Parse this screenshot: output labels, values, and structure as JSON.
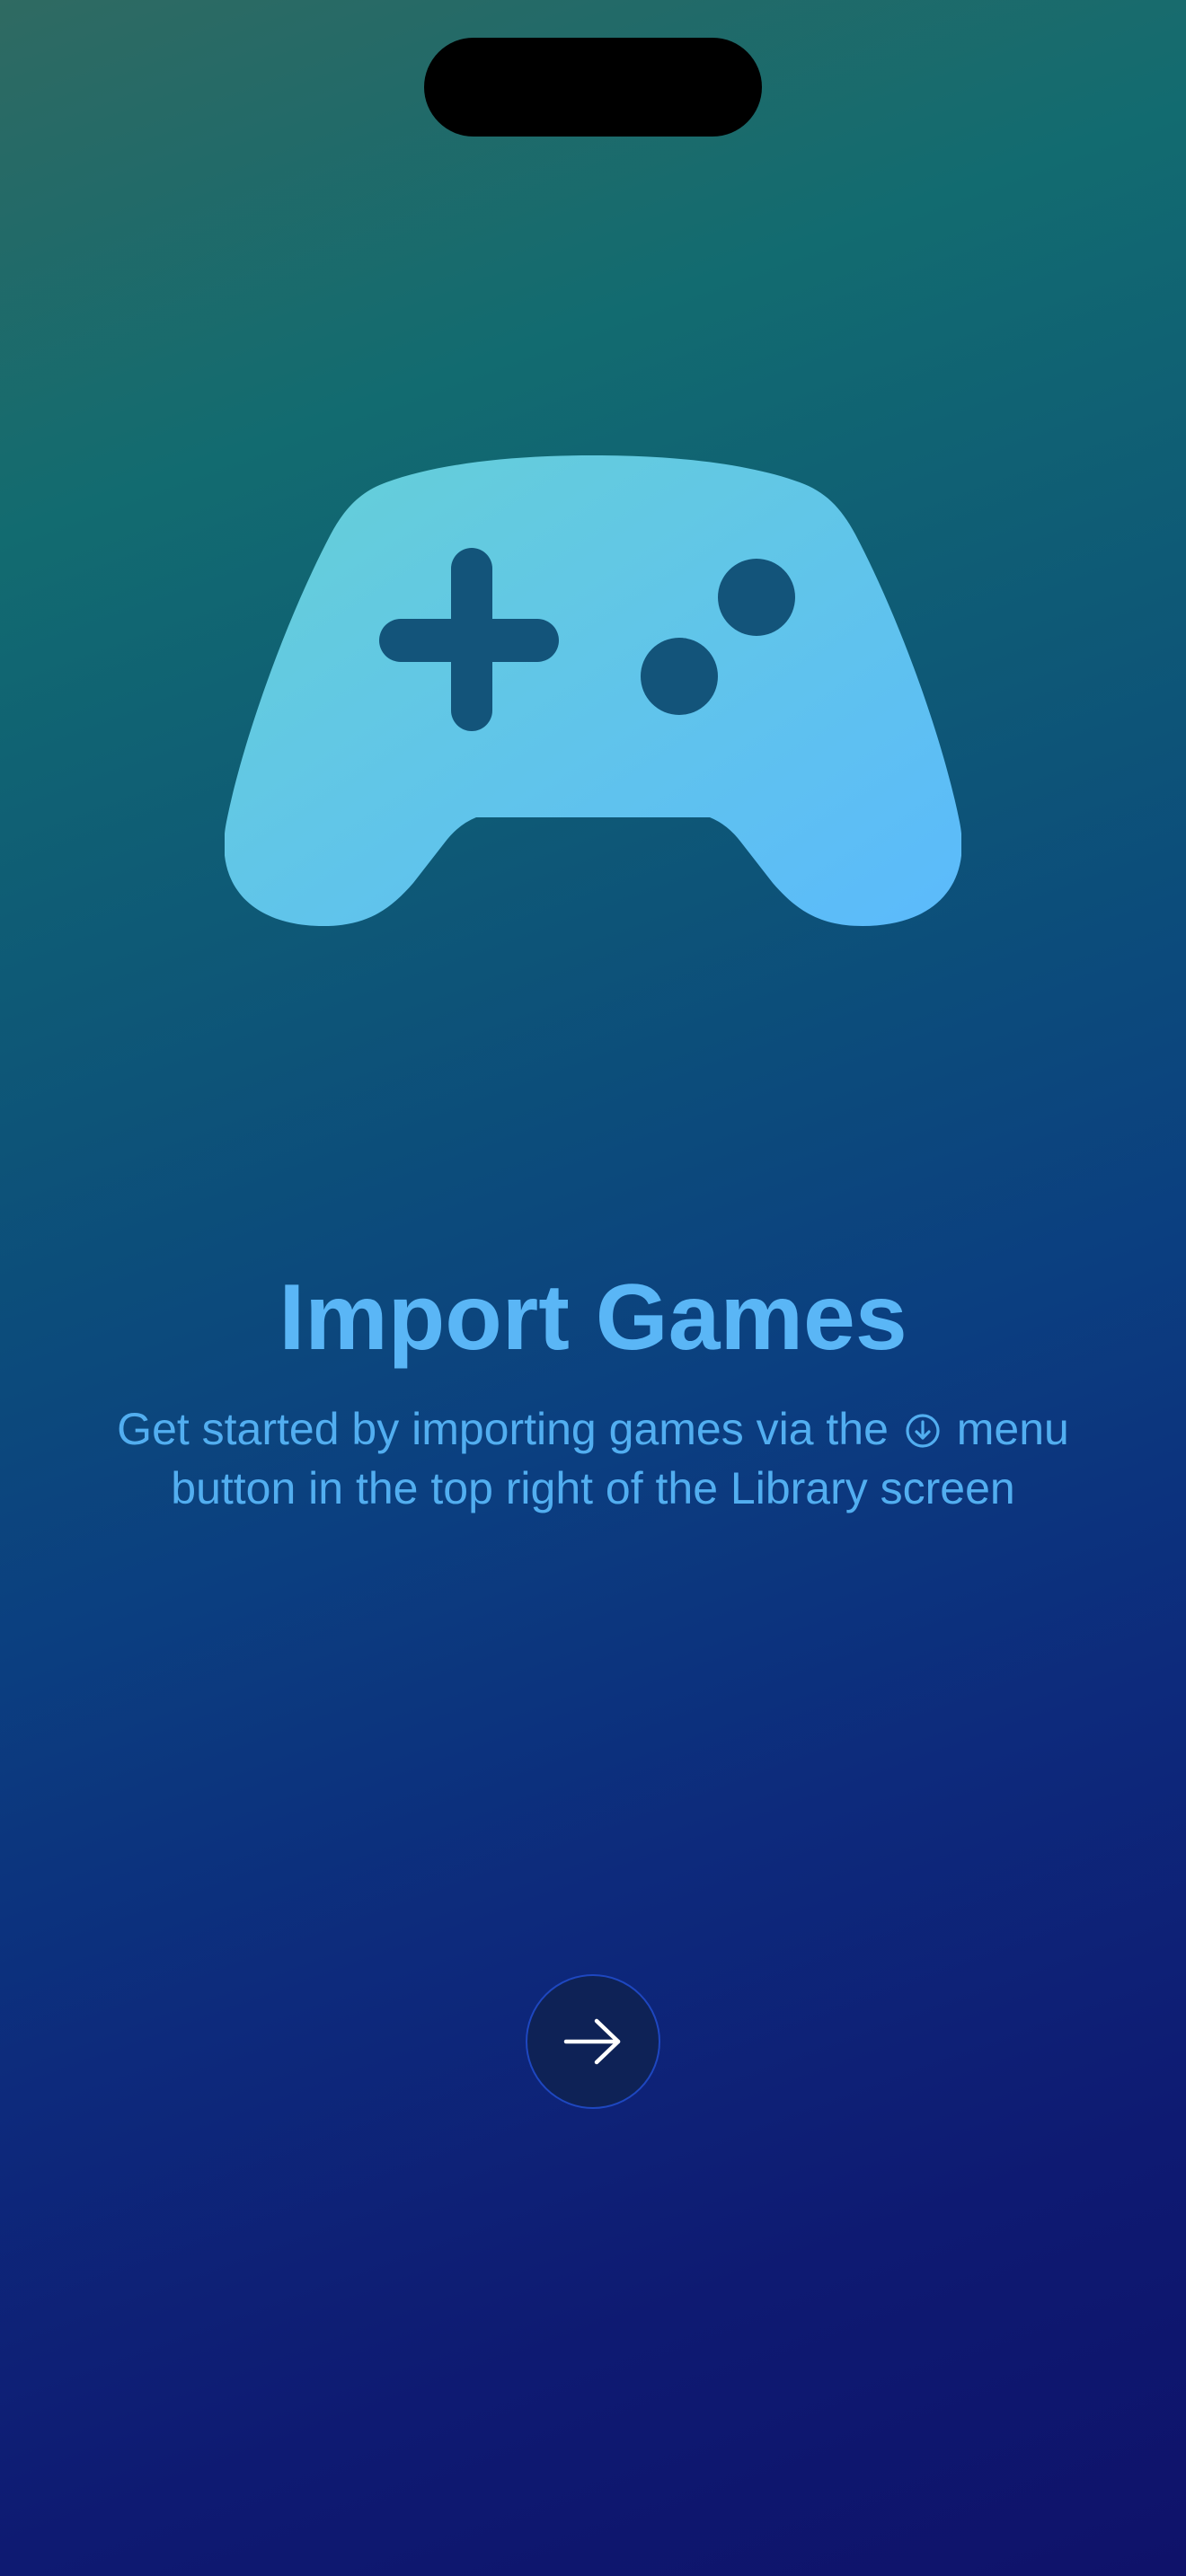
{
  "colors": {
    "accent": "#5ab6f6",
    "icon_gradient_start": "#63cfd9",
    "icon_gradient_end": "#5bbcfb",
    "button_fill": "#0e2256",
    "button_border": "#1e47c0"
  },
  "hero": {
    "icon": "game-controller-icon"
  },
  "onboarding": {
    "title": "Import Games",
    "subtitle_before": "Get started by importing games via the",
    "subtitle_icon": "arrow-down-circle-icon",
    "subtitle_after": "menu button in the top right of the Library screen"
  },
  "next_button": {
    "icon": "arrow-right-icon"
  }
}
